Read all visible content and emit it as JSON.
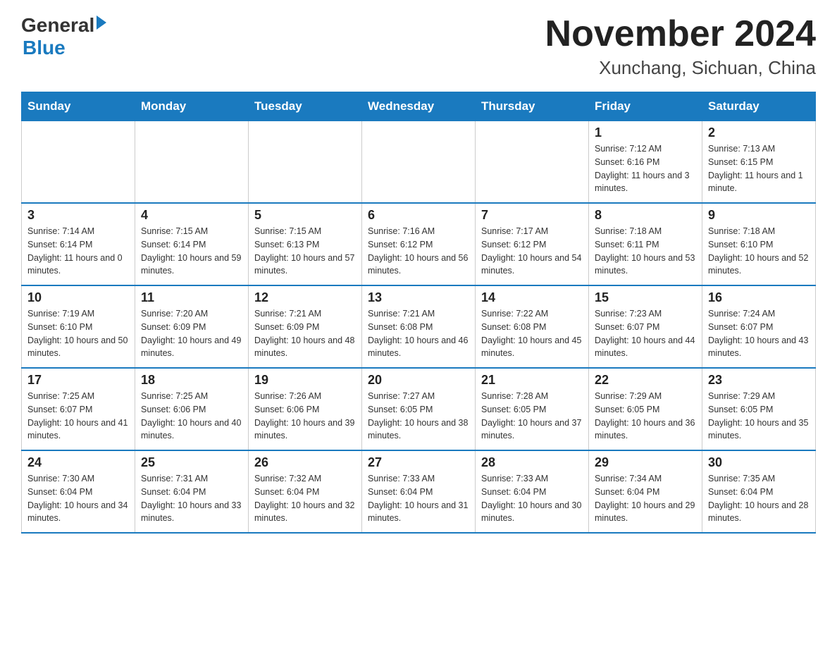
{
  "header": {
    "logo_general": "General",
    "logo_blue": "Blue",
    "title": "November 2024",
    "subtitle": "Xunchang, Sichuan, China"
  },
  "weekdays": [
    "Sunday",
    "Monday",
    "Tuesday",
    "Wednesday",
    "Thursday",
    "Friday",
    "Saturday"
  ],
  "weeks": [
    [
      {
        "day": "",
        "sunrise": "",
        "sunset": "",
        "daylight": ""
      },
      {
        "day": "",
        "sunrise": "",
        "sunset": "",
        "daylight": ""
      },
      {
        "day": "",
        "sunrise": "",
        "sunset": "",
        "daylight": ""
      },
      {
        "day": "",
        "sunrise": "",
        "sunset": "",
        "daylight": ""
      },
      {
        "day": "",
        "sunrise": "",
        "sunset": "",
        "daylight": ""
      },
      {
        "day": "1",
        "sunrise": "Sunrise: 7:12 AM",
        "sunset": "Sunset: 6:16 PM",
        "daylight": "Daylight: 11 hours and 3 minutes."
      },
      {
        "day": "2",
        "sunrise": "Sunrise: 7:13 AM",
        "sunset": "Sunset: 6:15 PM",
        "daylight": "Daylight: 11 hours and 1 minute."
      }
    ],
    [
      {
        "day": "3",
        "sunrise": "Sunrise: 7:14 AM",
        "sunset": "Sunset: 6:14 PM",
        "daylight": "Daylight: 11 hours and 0 minutes."
      },
      {
        "day": "4",
        "sunrise": "Sunrise: 7:15 AM",
        "sunset": "Sunset: 6:14 PM",
        "daylight": "Daylight: 10 hours and 59 minutes."
      },
      {
        "day": "5",
        "sunrise": "Sunrise: 7:15 AM",
        "sunset": "Sunset: 6:13 PM",
        "daylight": "Daylight: 10 hours and 57 minutes."
      },
      {
        "day": "6",
        "sunrise": "Sunrise: 7:16 AM",
        "sunset": "Sunset: 6:12 PM",
        "daylight": "Daylight: 10 hours and 56 minutes."
      },
      {
        "day": "7",
        "sunrise": "Sunrise: 7:17 AM",
        "sunset": "Sunset: 6:12 PM",
        "daylight": "Daylight: 10 hours and 54 minutes."
      },
      {
        "day": "8",
        "sunrise": "Sunrise: 7:18 AM",
        "sunset": "Sunset: 6:11 PM",
        "daylight": "Daylight: 10 hours and 53 minutes."
      },
      {
        "day": "9",
        "sunrise": "Sunrise: 7:18 AM",
        "sunset": "Sunset: 6:10 PM",
        "daylight": "Daylight: 10 hours and 52 minutes."
      }
    ],
    [
      {
        "day": "10",
        "sunrise": "Sunrise: 7:19 AM",
        "sunset": "Sunset: 6:10 PM",
        "daylight": "Daylight: 10 hours and 50 minutes."
      },
      {
        "day": "11",
        "sunrise": "Sunrise: 7:20 AM",
        "sunset": "Sunset: 6:09 PM",
        "daylight": "Daylight: 10 hours and 49 minutes."
      },
      {
        "day": "12",
        "sunrise": "Sunrise: 7:21 AM",
        "sunset": "Sunset: 6:09 PM",
        "daylight": "Daylight: 10 hours and 48 minutes."
      },
      {
        "day": "13",
        "sunrise": "Sunrise: 7:21 AM",
        "sunset": "Sunset: 6:08 PM",
        "daylight": "Daylight: 10 hours and 46 minutes."
      },
      {
        "day": "14",
        "sunrise": "Sunrise: 7:22 AM",
        "sunset": "Sunset: 6:08 PM",
        "daylight": "Daylight: 10 hours and 45 minutes."
      },
      {
        "day": "15",
        "sunrise": "Sunrise: 7:23 AM",
        "sunset": "Sunset: 6:07 PM",
        "daylight": "Daylight: 10 hours and 44 minutes."
      },
      {
        "day": "16",
        "sunrise": "Sunrise: 7:24 AM",
        "sunset": "Sunset: 6:07 PM",
        "daylight": "Daylight: 10 hours and 43 minutes."
      }
    ],
    [
      {
        "day": "17",
        "sunrise": "Sunrise: 7:25 AM",
        "sunset": "Sunset: 6:07 PM",
        "daylight": "Daylight: 10 hours and 41 minutes."
      },
      {
        "day": "18",
        "sunrise": "Sunrise: 7:25 AM",
        "sunset": "Sunset: 6:06 PM",
        "daylight": "Daylight: 10 hours and 40 minutes."
      },
      {
        "day": "19",
        "sunrise": "Sunrise: 7:26 AM",
        "sunset": "Sunset: 6:06 PM",
        "daylight": "Daylight: 10 hours and 39 minutes."
      },
      {
        "day": "20",
        "sunrise": "Sunrise: 7:27 AM",
        "sunset": "Sunset: 6:05 PM",
        "daylight": "Daylight: 10 hours and 38 minutes."
      },
      {
        "day": "21",
        "sunrise": "Sunrise: 7:28 AM",
        "sunset": "Sunset: 6:05 PM",
        "daylight": "Daylight: 10 hours and 37 minutes."
      },
      {
        "day": "22",
        "sunrise": "Sunrise: 7:29 AM",
        "sunset": "Sunset: 6:05 PM",
        "daylight": "Daylight: 10 hours and 36 minutes."
      },
      {
        "day": "23",
        "sunrise": "Sunrise: 7:29 AM",
        "sunset": "Sunset: 6:05 PM",
        "daylight": "Daylight: 10 hours and 35 minutes."
      }
    ],
    [
      {
        "day": "24",
        "sunrise": "Sunrise: 7:30 AM",
        "sunset": "Sunset: 6:04 PM",
        "daylight": "Daylight: 10 hours and 34 minutes."
      },
      {
        "day": "25",
        "sunrise": "Sunrise: 7:31 AM",
        "sunset": "Sunset: 6:04 PM",
        "daylight": "Daylight: 10 hours and 33 minutes."
      },
      {
        "day": "26",
        "sunrise": "Sunrise: 7:32 AM",
        "sunset": "Sunset: 6:04 PM",
        "daylight": "Daylight: 10 hours and 32 minutes."
      },
      {
        "day": "27",
        "sunrise": "Sunrise: 7:33 AM",
        "sunset": "Sunset: 6:04 PM",
        "daylight": "Daylight: 10 hours and 31 minutes."
      },
      {
        "day": "28",
        "sunrise": "Sunrise: 7:33 AM",
        "sunset": "Sunset: 6:04 PM",
        "daylight": "Daylight: 10 hours and 30 minutes."
      },
      {
        "day": "29",
        "sunrise": "Sunrise: 7:34 AM",
        "sunset": "Sunset: 6:04 PM",
        "daylight": "Daylight: 10 hours and 29 minutes."
      },
      {
        "day": "30",
        "sunrise": "Sunrise: 7:35 AM",
        "sunset": "Sunset: 6:04 PM",
        "daylight": "Daylight: 10 hours and 28 minutes."
      }
    ]
  ]
}
